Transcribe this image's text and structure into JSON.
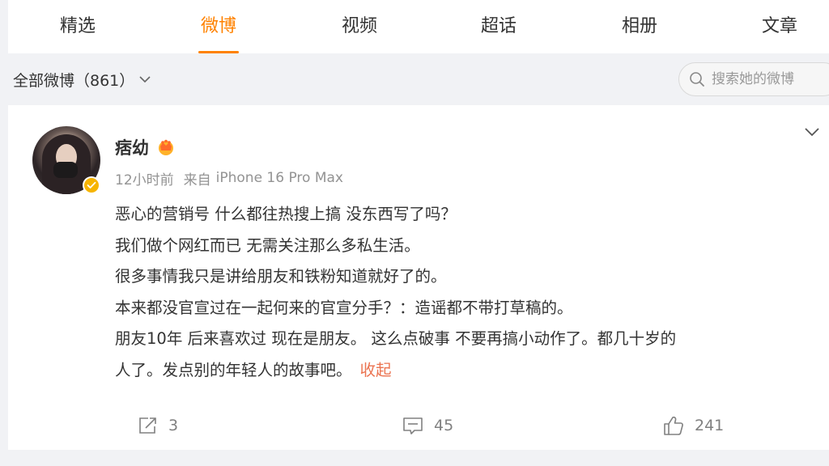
{
  "tabs": [
    {
      "label": "精选",
      "active": false
    },
    {
      "label": "微博",
      "active": true
    },
    {
      "label": "视频",
      "active": false
    },
    {
      "label": "超话",
      "active": false
    },
    {
      "label": "相册",
      "active": false
    },
    {
      "label": "文章",
      "active": false
    }
  ],
  "filter": {
    "label": "全部微博（861）",
    "icon": "chevron-down-icon"
  },
  "search": {
    "placeholder": "搜索她的微博",
    "icon": "search-icon"
  },
  "post": {
    "author": "痞幼",
    "author_badge_icon": "crown-icon",
    "verified_icon": "verified-badge-icon",
    "time": "12小时前",
    "from_label": "来自",
    "device": "iPhone 16 Pro Max",
    "content_lines": [
      "恶心的营销号 什么都往热搜上搞 没东西写了吗？",
      "我们做个网红而已 无需关注那么多私生活。",
      "很多事情我只是讲给朋友和铁粉知道就好了的。",
      "本来都没官宣过在一起何来的官宣分手？：造谣都不带打草稿的。",
      "朋友10年 后来喜欢过 现在是朋友。 这么点破事 不要再搞小动作了。都几十岁的",
      "人了。发点别的年轻人的故事吧。"
    ],
    "collapse_label": "收起",
    "more_icon": "chevron-down-icon",
    "stats": {
      "reposts": "3",
      "comments": "45",
      "likes": "241"
    }
  },
  "colors": {
    "accent": "#ff8200",
    "link": "#eb7350",
    "verified": "#f6b400",
    "meta_text": "#939393",
    "page_bg": "#f1f2f5"
  }
}
